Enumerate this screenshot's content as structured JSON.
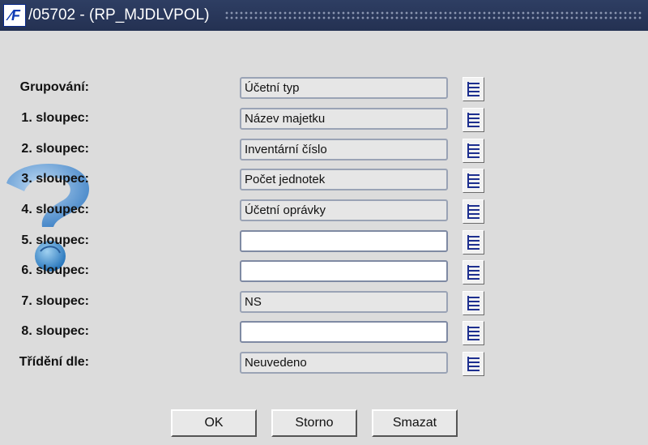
{
  "window": {
    "title": "/05702 - (RP_MJDLVPOL)",
    "icon_text": "⁄F"
  },
  "form": {
    "rows": [
      {
        "label": "Grupování:",
        "value": "Účetní typ"
      },
      {
        "label": "1. sloupec:",
        "value": "Název majetku"
      },
      {
        "label": "2. sloupec:",
        "value": "Inventární číslo"
      },
      {
        "label": "3. sloupec:",
        "value": "Počet jednotek"
      },
      {
        "label": "4. sloupec:",
        "value": "Účetní oprávky"
      },
      {
        "label": "5. sloupec:",
        "value": ""
      },
      {
        "label": "6. sloupec:",
        "value": ""
      },
      {
        "label": "7. sloupec:",
        "value": "NS"
      },
      {
        "label": "8. sloupec:",
        "value": ""
      },
      {
        "label": "Třídění dle:",
        "value": "Neuvedeno"
      }
    ]
  },
  "buttons": {
    "ok": "OK",
    "storno": "Storno",
    "smazat": "Smazat"
  },
  "colors": {
    "titlebar": "#2e3e63",
    "background": "#dcdcdc",
    "icon_blue": "#1d2f8f"
  },
  "icons": {
    "help": "question-mark-icon",
    "lov": "list-of-values-icon"
  }
}
